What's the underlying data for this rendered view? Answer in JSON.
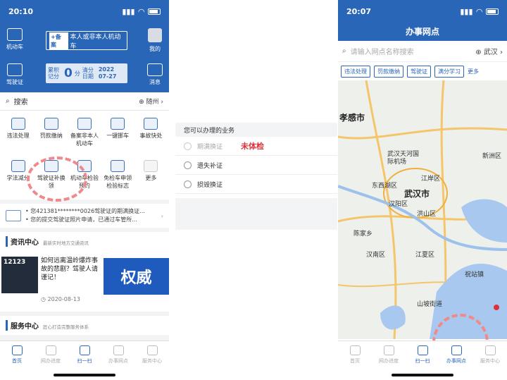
{
  "left": {
    "status_time": "20:10",
    "header": {
      "vehicle_label": "机动车",
      "license_label": "驾驶证",
      "plate_tag": "+备案",
      "plate_text": "本人或非本人机动车",
      "score_label": "累积记分",
      "score_value": "0",
      "score_unit": "分",
      "clear_label": "清分日期",
      "clear_year": "2022",
      "clear_date": "07-27",
      "mine_label": "我的",
      "message_label": "消息"
    },
    "search": {
      "label": "搜索",
      "location": "随州"
    },
    "services": [
      "违法处理",
      "罚款缴纳",
      "备案非本人机动车",
      "一键挪车",
      "事故快处",
      "学法减分",
      "驾驶证补换领",
      "机动车检验预约",
      "免检车申领检验标志",
      "更多"
    ],
    "notices": [
      "您421381********0026驾驶证的期满换证...",
      "您的提交驾驶证照片申请，已通过车管所..."
    ],
    "news_section": {
      "title": "资讯中心",
      "subtitle": "最新实时地方交通资讯"
    },
    "news": {
      "thumb_text": "12123",
      "headline": "如何远离温岭爆炸事故的悲剧？驾驶人请谨记！",
      "date": "2020-08-13",
      "banner_text": "权威"
    },
    "service_section": {
      "title": "服务中心",
      "subtitle": "匠心打造完整服务体系"
    },
    "tabs": [
      "首页",
      "网办进度",
      "扫一扫",
      "办事网点",
      "服务中心"
    ]
  },
  "middle": {
    "section_title": "您可以办理的业务",
    "options": [
      {
        "label": "期满换证",
        "disabled": true
      },
      {
        "label": "遗失补证",
        "disabled": false
      },
      {
        "label": "损毁换证",
        "disabled": false
      }
    ],
    "annotation": "未体检"
  },
  "right": {
    "status_time": "20:07",
    "title": "办事网点",
    "search_placeholder": "请输入网点名称搜索",
    "city": "武汉",
    "chips": [
      "违法处理",
      "罚款缴纳",
      "驾驶证",
      "满分学习"
    ],
    "more": "更多",
    "map_labels": [
      "孝感市",
      "武汉天河国际机场",
      "东西湖区",
      "江岸区",
      "武汉市",
      "汉阳区",
      "洪山区",
      "陈家乡",
      "汉南区",
      "江夏区",
      "山坡街道",
      "祝站镇",
      "新洲区"
    ],
    "tabs": [
      "首页",
      "网办进度",
      "扫一扫",
      "办事网点",
      "服务中心"
    ]
  }
}
